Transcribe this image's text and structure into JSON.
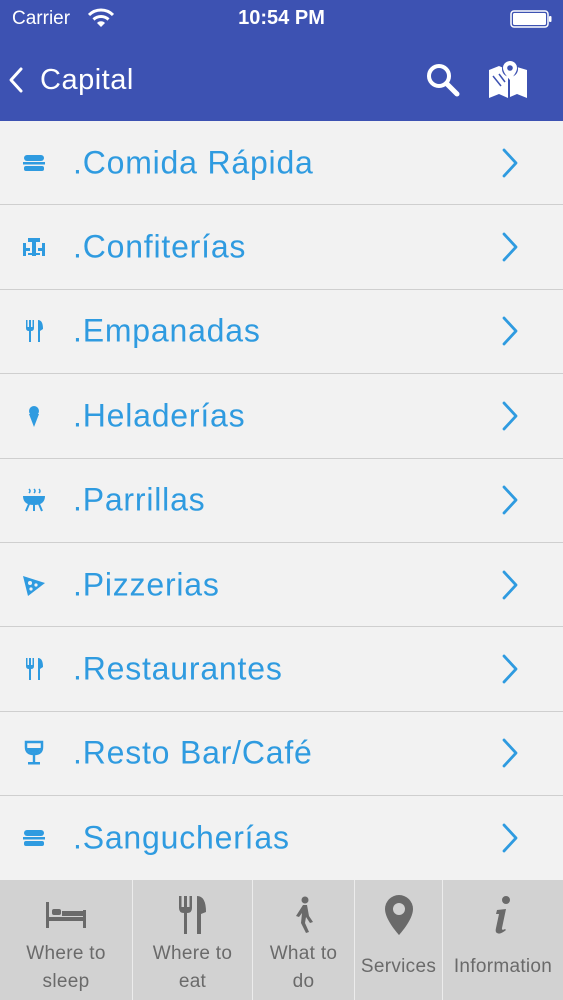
{
  "status_bar": {
    "carrier": "Carrier",
    "time": "10:54 PM"
  },
  "nav": {
    "back_label": "Capital"
  },
  "colors": {
    "header": "#3d52b2",
    "accent": "#2f9be0",
    "tab_bar": "#d2d2d2"
  },
  "list": {
    "items": [
      {
        "label": ".Comida Rápida",
        "icon": "burger-icon"
      },
      {
        "label": ".Confiterías",
        "icon": "table-chairs-icon"
      },
      {
        "label": ".Empanadas",
        "icon": "fork-knife-icon"
      },
      {
        "label": ".Heladerías",
        "icon": "ice-cream-icon"
      },
      {
        "label": ".Parrillas",
        "icon": "grill-icon"
      },
      {
        "label": ".Pizzerias",
        "icon": "pizza-icon"
      },
      {
        "label": ".Restaurantes",
        "icon": "fork-knife-icon"
      },
      {
        "label": ".Resto Bar/Café",
        "icon": "wine-glass-icon"
      },
      {
        "label": ".Sangucherías",
        "icon": "burger-icon"
      }
    ]
  },
  "tab_bar": {
    "tabs": [
      {
        "line1": "Where to",
        "line2": "sleep",
        "icon": "bed-icon"
      },
      {
        "line1": "Where to",
        "line2": "eat",
        "icon": "fork-knife-icon"
      },
      {
        "line1": "What to",
        "line2": "do",
        "icon": "walking-person-icon"
      },
      {
        "label": "Services",
        "icon": "location-pin-icon"
      },
      {
        "label": "Information",
        "icon": "info-icon"
      }
    ]
  }
}
